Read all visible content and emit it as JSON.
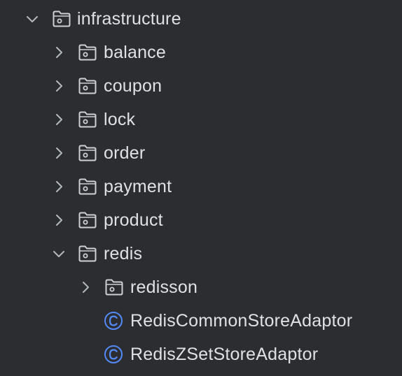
{
  "tree": {
    "root": {
      "label": "infrastructure",
      "expanded": true,
      "icon": "package-folder-icon"
    },
    "children": [
      {
        "label": "balance",
        "icon": "package-folder-icon",
        "expanded": false
      },
      {
        "label": "coupon",
        "icon": "package-folder-icon",
        "expanded": false
      },
      {
        "label": "lock",
        "icon": "package-folder-icon",
        "expanded": false
      },
      {
        "label": "order",
        "icon": "package-folder-icon",
        "expanded": false
      },
      {
        "label": "payment",
        "icon": "package-folder-icon",
        "expanded": false
      },
      {
        "label": "product",
        "icon": "package-folder-icon",
        "expanded": false
      },
      {
        "label": "redis",
        "icon": "package-folder-icon",
        "expanded": true
      }
    ],
    "redis_children": [
      {
        "label": "redisson",
        "icon": "package-folder-icon",
        "expanded": false
      },
      {
        "label": "RedisCommonStoreAdaptor",
        "icon": "class-icon"
      },
      {
        "label": "RedisZSetStoreAdaptor",
        "icon": "class-icon"
      }
    ]
  },
  "colors": {
    "background": "#2b2d30",
    "text": "#dfe1e5",
    "icon_stroke": "#ced0d6",
    "chevron": "#b4b8bf",
    "class_icon": "#548af7"
  }
}
